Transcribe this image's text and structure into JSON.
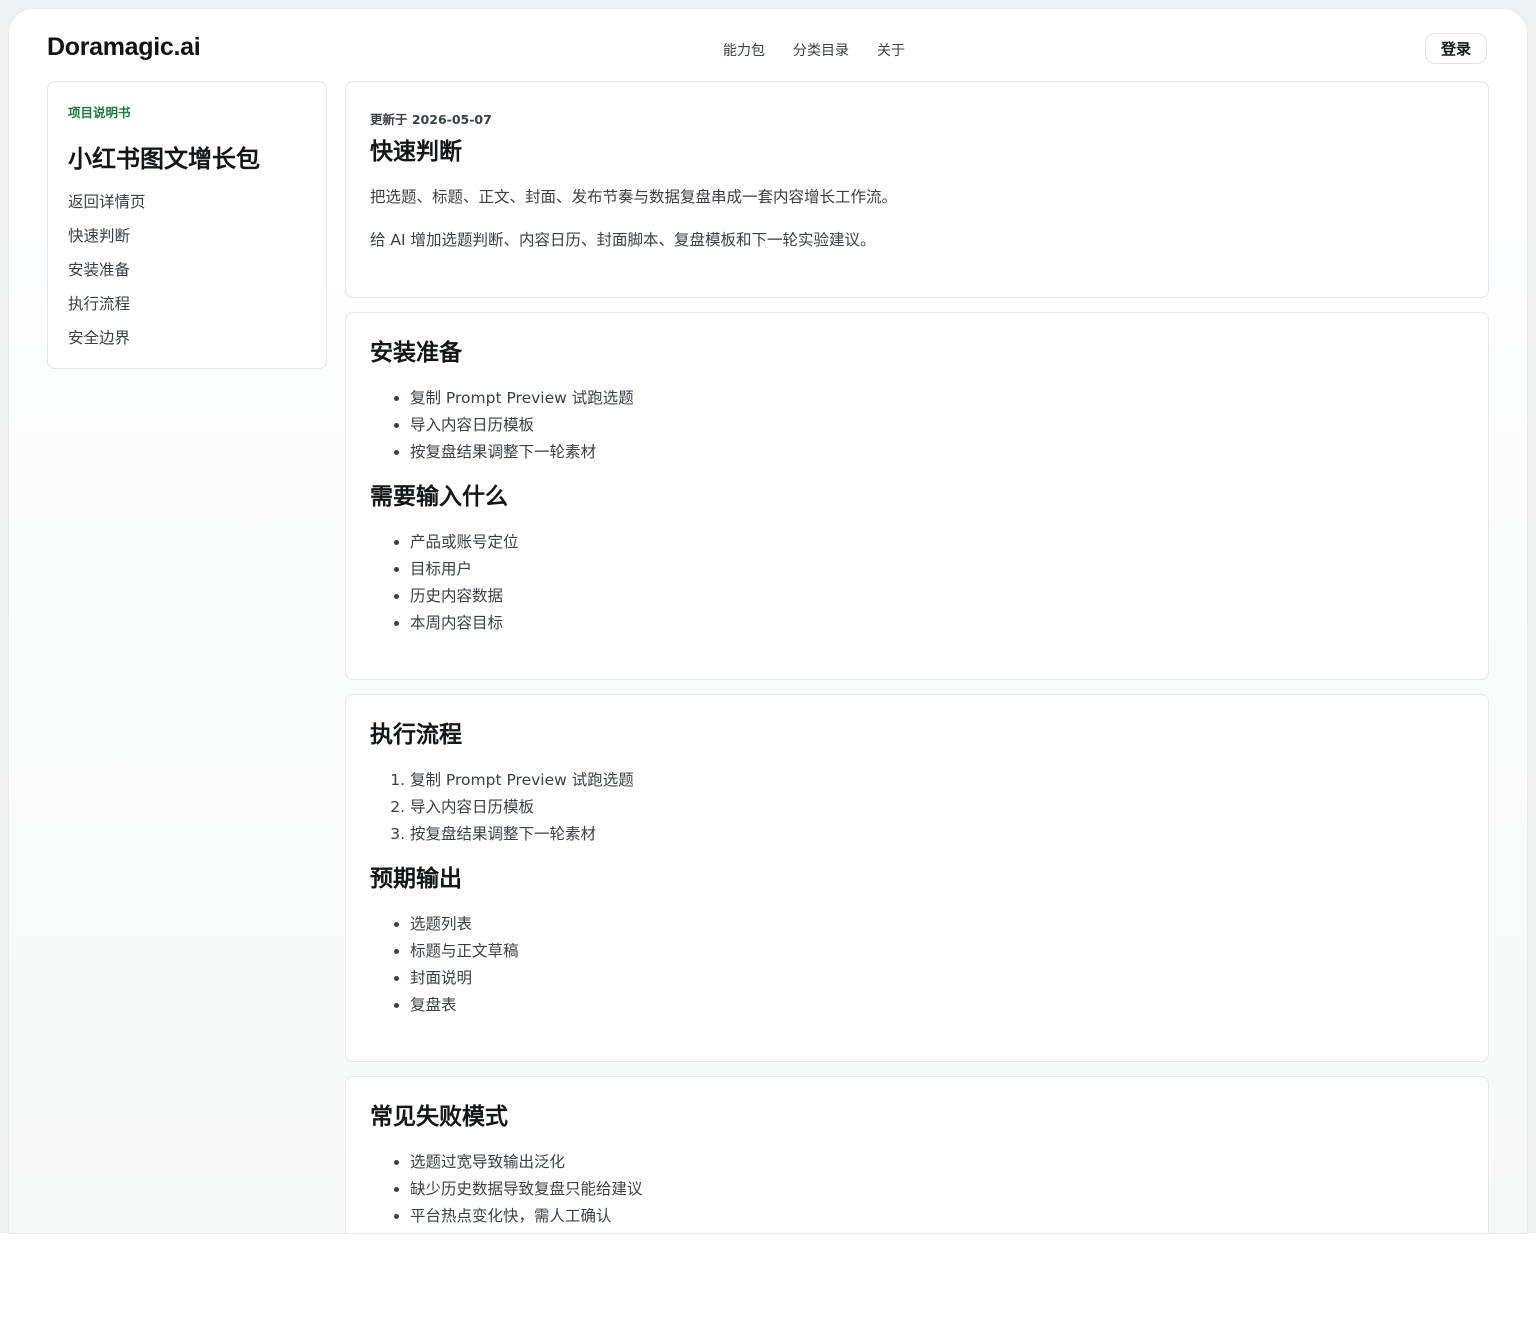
{
  "header": {
    "brand": "Doramagic.ai",
    "nav": [
      "能力包",
      "分类目录",
      "关于"
    ],
    "login_label": "登录"
  },
  "sidebar": {
    "eyebrow": "项目说明书",
    "title": "小红书图文增长包",
    "links": [
      "返回详情页",
      "快速判断",
      "安装准备",
      "执行流程",
      "安全边界"
    ]
  },
  "quick": {
    "updated": "更新于 2026-05-07",
    "title": "快速判断",
    "paragraphs": [
      "把选题、标题、正文、封面、发布节奏与数据复盘串成一套内容增长工作流。",
      "给 AI 增加选题判断、内容日历、封面脚本、复盘模板和下一轮实验建议。"
    ]
  },
  "install": {
    "title": "安装准备",
    "items": [
      "复制 Prompt Preview 试跑选题",
      "导入内容日历模板",
      "按复盘结果调整下一轮素材"
    ],
    "inputs_title": "需要输入什么",
    "inputs": [
      "产品或账号定位",
      "目标用户",
      "历史内容数据",
      "本周内容目标"
    ]
  },
  "flow": {
    "title": "执行流程",
    "steps": [
      "复制 Prompt Preview 试跑选题",
      "导入内容日历模板",
      "按复盘结果调整下一轮素材"
    ],
    "output_title": "预期输出",
    "outputs": [
      "选题列表",
      "标题与正文草稿",
      "封面说明",
      "复盘表"
    ]
  },
  "failure": {
    "title": "常见失败模式",
    "items": [
      "选题过宽导致输出泛化",
      "缺少历史数据导致复盘只能给建议",
      "平台热点变化快，需人工确认"
    ]
  }
}
